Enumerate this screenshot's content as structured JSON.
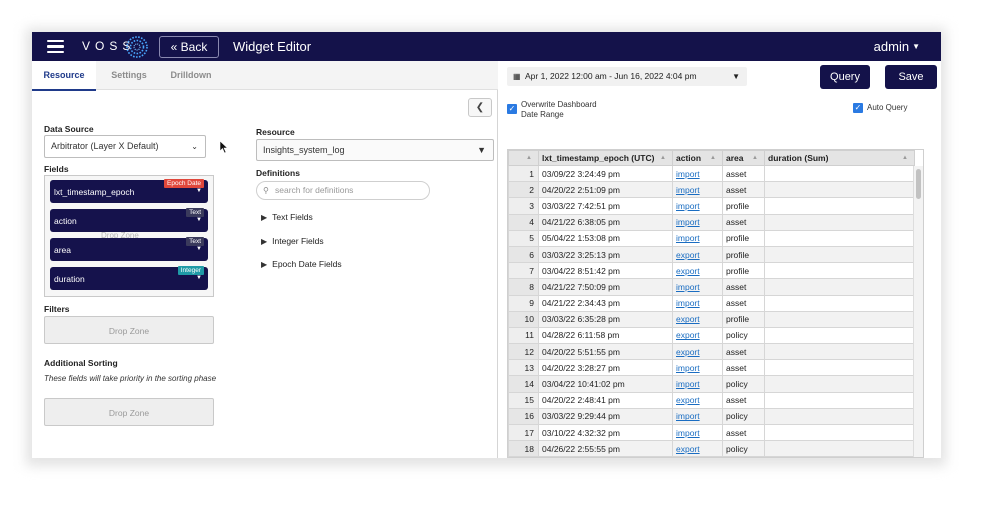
{
  "header": {
    "logo_text": "VOSS",
    "back_label": "« Back",
    "title": "Widget Editor",
    "user": "admin"
  },
  "tabs": [
    {
      "label": "Resource",
      "active": true
    },
    {
      "label": "Settings",
      "active": false
    },
    {
      "label": "Drilldown",
      "active": false
    }
  ],
  "data_source": {
    "label": "Data Source",
    "value": "Arbitrator (Layer X Default)"
  },
  "fields": {
    "label": "Fields",
    "drop_zone": "Drop Zone",
    "items": [
      {
        "name": "lxt_timestamp_epoch",
        "tag": "Epoch Date",
        "tag_color": "#e0473b"
      },
      {
        "name": "action",
        "tag": "Text",
        "tag_color": "#3a3a5c"
      },
      {
        "name": "area",
        "tag": "Text",
        "tag_color": "#3a3a5c"
      },
      {
        "name": "duration",
        "tag": "Integer",
        "tag_color": "#1f9aa6"
      }
    ]
  },
  "filters": {
    "label": "Filters",
    "drop_zone": "Drop Zone"
  },
  "sorting": {
    "label": "Additional Sorting",
    "note": "These fields will take priority in the sorting phase",
    "drop_zone": "Drop Zone"
  },
  "resource": {
    "label": "Resource",
    "value": "Insights_system_log"
  },
  "definitions": {
    "label": "Definitions",
    "search_placeholder": "search for definitions",
    "groups": [
      "Text Fields",
      "Integer Fields",
      "Epoch Date Fields"
    ]
  },
  "toolbar": {
    "date_range": "Apr 1, 2022 12:00 am - Jun 16, 2022 4:04 pm",
    "query_label": "Query",
    "save_label": "Save",
    "overwrite_label_1": "Overwrite Dashboard",
    "overwrite_label_2": "Date Range",
    "auto_query_label": "Auto Query"
  },
  "table": {
    "columns": [
      "lxt_timestamp_epoch (UTC)",
      "action",
      "area",
      "duration (Sum)"
    ],
    "rows": [
      [
        "1",
        "03/09/22 3:24:49 pm",
        "import",
        "asset",
        ""
      ],
      [
        "2",
        "04/20/22 2:51:09 pm",
        "import",
        "asset",
        ""
      ],
      [
        "3",
        "03/03/22 7:42:51 pm",
        "import",
        "profile",
        ""
      ],
      [
        "4",
        "04/21/22 6:38:05 pm",
        "import",
        "asset",
        ""
      ],
      [
        "5",
        "05/04/22 1:53:08 pm",
        "import",
        "profile",
        ""
      ],
      [
        "6",
        "03/03/22 3:25:13 pm",
        "export",
        "profile",
        ""
      ],
      [
        "7",
        "03/04/22 8:51:42 pm",
        "export",
        "profile",
        ""
      ],
      [
        "8",
        "04/21/22 7:50:09 pm",
        "import",
        "asset",
        ""
      ],
      [
        "9",
        "04/21/22 2:34:43 pm",
        "import",
        "asset",
        ""
      ],
      [
        "10",
        "03/03/22 6:35:28 pm",
        "export",
        "profile",
        ""
      ],
      [
        "11",
        "04/28/22 6:11:58 pm",
        "export",
        "policy",
        ""
      ],
      [
        "12",
        "04/20/22 5:51:55 pm",
        "export",
        "asset",
        ""
      ],
      [
        "13",
        "04/20/22 3:28:27 pm",
        "import",
        "asset",
        ""
      ],
      [
        "14",
        "03/04/22 10:41:02 pm",
        "import",
        "policy",
        ""
      ],
      [
        "15",
        "04/20/22 2:48:41 pm",
        "export",
        "asset",
        ""
      ],
      [
        "16",
        "03/03/22 9:29:44 pm",
        "import",
        "policy",
        ""
      ],
      [
        "17",
        "03/10/22 4:32:32 pm",
        "import",
        "asset",
        ""
      ],
      [
        "18",
        "04/26/22 2:55:55 pm",
        "export",
        "policy",
        ""
      ]
    ]
  }
}
